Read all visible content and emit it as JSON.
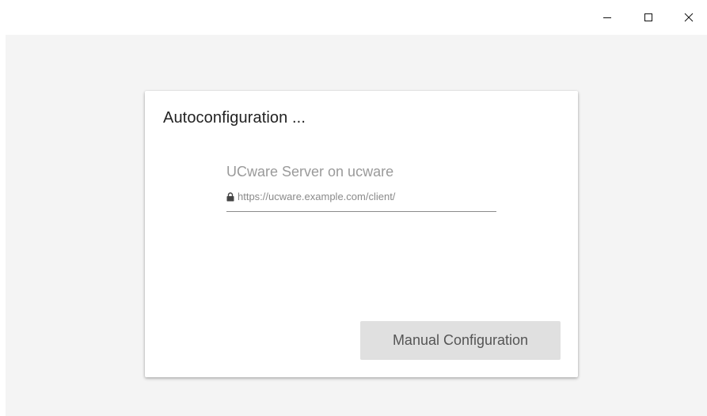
{
  "window_controls": {
    "minimize_icon": "minimize-icon",
    "maximize_icon": "maximize-icon",
    "close_icon": "close-icon"
  },
  "dialog": {
    "title": "Autoconfiguration ...",
    "server": {
      "name": "UCware Server on ucware",
      "url": "https://ucware.example.com/client/",
      "secure_icon": "lock-icon"
    },
    "manual_button_label": "Manual Configuration"
  },
  "colors": {
    "background": "#f4f4f4",
    "card": "#ffffff",
    "button_bg": "#e0e0e0",
    "button_text": "#555555",
    "muted_text": "#9a9a9a"
  }
}
